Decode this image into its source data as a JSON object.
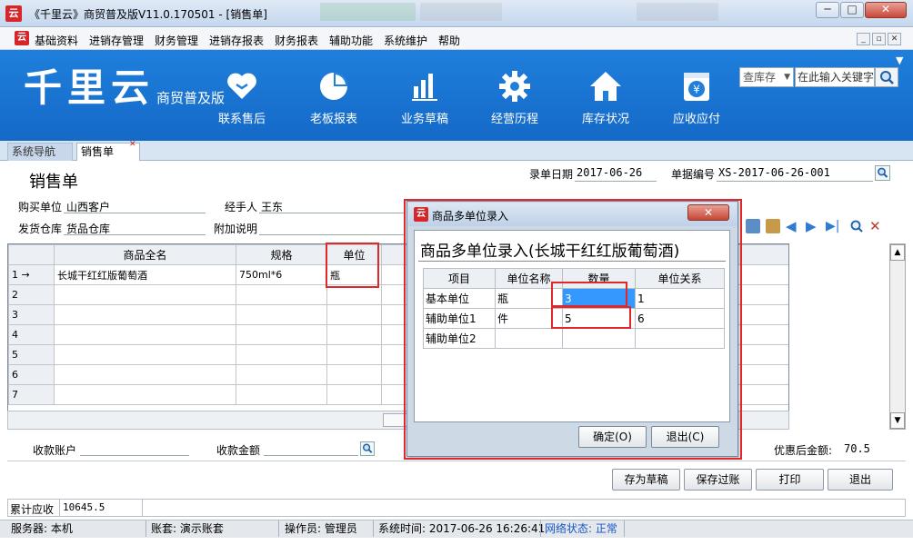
{
  "window": {
    "title": "《千里云》商贸普及版V11.0.170501 - [销售单]",
    "minimize": "─",
    "maximize": "□",
    "close": "✕"
  },
  "menu": {
    "items": [
      "基础资料",
      "进销存管理",
      "财务管理",
      "进销存报表",
      "财务报表",
      "辅助功能",
      "系统维护",
      "帮助"
    ],
    "mdi_min": "_",
    "mdi_restore": "▫",
    "mdi_close": "✕"
  },
  "banner": {
    "brand": "千里云",
    "edition": "商贸普及版",
    "nav": [
      {
        "label": "联系售后",
        "icon": "heart-hands-icon"
      },
      {
        "label": "老板报表",
        "icon": "pie-chart-icon"
      },
      {
        "label": "业务草稿",
        "icon": "bar-chart-icon"
      },
      {
        "label": "经营历程",
        "icon": "gear-icon"
      },
      {
        "label": "库存状况",
        "icon": "home-icon"
      },
      {
        "label": "应收应付",
        "icon": "yen-calendar-icon"
      }
    ],
    "search_scope": "查库存",
    "search_placeholder": "在此输入关键字"
  },
  "tabs": [
    {
      "label": "系统导航"
    },
    {
      "label": "销售单"
    }
  ],
  "form": {
    "title": "销售单",
    "date_label": "录单日期",
    "date_value": "2017-06-26",
    "doc_no_label": "单据编号",
    "doc_no_value": "XS-2017-06-26-001",
    "buyer_label": "购买单位",
    "buyer_value": "山西客户",
    "handler_label": "经手人",
    "handler_value": "王东",
    "warehouse_label": "发货仓库",
    "warehouse_value": "货品仓库",
    "note_label": "附加说明",
    "note_value": ""
  },
  "grid": {
    "columns": [
      "",
      "商品全名",
      "规格",
      "单位",
      "",
      ""
    ],
    "rows": [
      {
        "no": "1 →",
        "name": "长城干红红版葡萄酒",
        "spec": "750ml*6",
        "unit": "瓶"
      },
      {
        "no": "2",
        "name": "",
        "spec": "",
        "unit": ""
      },
      {
        "no": "3",
        "name": "",
        "spec": "",
        "unit": ""
      },
      {
        "no": "4",
        "name": "",
        "spec": "",
        "unit": ""
      },
      {
        "no": "5",
        "name": "",
        "spec": "",
        "unit": ""
      },
      {
        "no": "6",
        "name": "",
        "spec": "",
        "unit": ""
      },
      {
        "no": "7",
        "name": "",
        "spec": "",
        "unit": ""
      }
    ]
  },
  "footer": {
    "account_label": "收款账户",
    "account_value": "",
    "amount_label": "收款金额",
    "amount_value": "",
    "discount_label": "优惠后金额:",
    "discount_value": "70.5",
    "buttons": {
      "draft": "存为草稿",
      "save": "保存过账",
      "print": "打印",
      "exit": "退出"
    },
    "receivable_label": "累计应收",
    "receivable_value": "10645.5"
  },
  "status": {
    "server": "服务器: 本机",
    "account_set": "账套: 演示账套",
    "operator": "操作员: 管理员",
    "system_time": "系统时间: 2017-06-26 16:26:41",
    "network": "网络状态: 正常"
  },
  "dialog": {
    "title": "商品多单位录入",
    "heading": "商品多单位录入(长城干红红版葡萄酒)",
    "columns": [
      "项目",
      "单位名称",
      "数量",
      "单位关系"
    ],
    "rows": [
      {
        "item": "基本单位",
        "unit": "瓶",
        "qty": "3",
        "relation": "1"
      },
      {
        "item": "辅助单位1",
        "unit": "件",
        "qty": "5",
        "relation": "6"
      },
      {
        "item": "辅助单位2",
        "unit": "",
        "qty": "",
        "relation": ""
      }
    ],
    "ok": "确定(O)",
    "cancel": "退出(C)",
    "close": "✕"
  },
  "colors": {
    "accent": "#1a74d4",
    "highlight": "#e0272a",
    "selection": "#3399ff"
  }
}
